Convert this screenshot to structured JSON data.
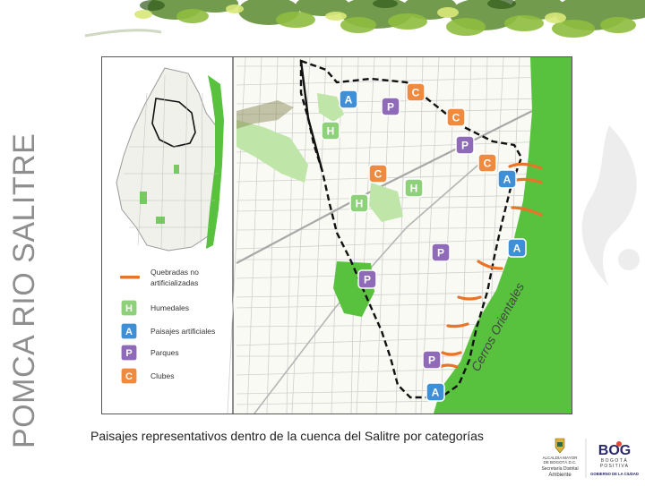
{
  "header": {
    "vertical_title": "POMCA RIO SALITRE"
  },
  "legend": {
    "items": [
      {
        "symbol": "",
        "color": "#e8742a",
        "label": "Quebradas no\nartificializadas"
      },
      {
        "symbol": "H",
        "color": "#8fd17a",
        "label": "Humedales"
      },
      {
        "symbol": "A",
        "color": "#3e8fd6",
        "label": "Paisajes artificiales"
      },
      {
        "symbol": "P",
        "color": "#8e6ab8",
        "label": "Parques"
      },
      {
        "symbol": "C",
        "color": "#f08a3e",
        "label": "Clubes"
      }
    ]
  },
  "map": {
    "hills_label": "Cerros Orientales",
    "markers": [
      {
        "letter": "A",
        "cat": "A"
      },
      {
        "letter": "P",
        "cat": "P"
      },
      {
        "letter": "C",
        "cat": "C"
      },
      {
        "letter": "C",
        "cat": "C"
      },
      {
        "letter": "H",
        "cat": "H"
      },
      {
        "letter": "P",
        "cat": "P"
      },
      {
        "letter": "C",
        "cat": "C"
      },
      {
        "letter": "C",
        "cat": "C"
      },
      {
        "letter": "A",
        "cat": "A"
      },
      {
        "letter": "H",
        "cat": "H"
      },
      {
        "letter": "H",
        "cat": "H"
      },
      {
        "letter": "A",
        "cat": "A"
      },
      {
        "letter": "P",
        "cat": "P"
      },
      {
        "letter": "P",
        "cat": "P"
      },
      {
        "letter": "P",
        "cat": "P"
      },
      {
        "letter": "A",
        "cat": "A"
      }
    ]
  },
  "caption": "Paisajes representativos dentro de la cuenca del Salitre por categorías",
  "logos": {
    "alcaldia_lines": [
      "ALCALDÍA MAYOR",
      "DE BOGOTÁ D.C.",
      "Secretaría Distrital",
      "Ambiente"
    ],
    "bog_lines": [
      "BOG",
      "BOGOTÁ",
      "POSITIVA",
      "GOBIERNO DE LA CIUDAD"
    ]
  },
  "colors": {
    "park_green": "#58c23e",
    "light_green": "#bfe6a8",
    "boundary": "#111111",
    "road": "#c9c9c9",
    "title_gray": "#8e8e8e"
  }
}
